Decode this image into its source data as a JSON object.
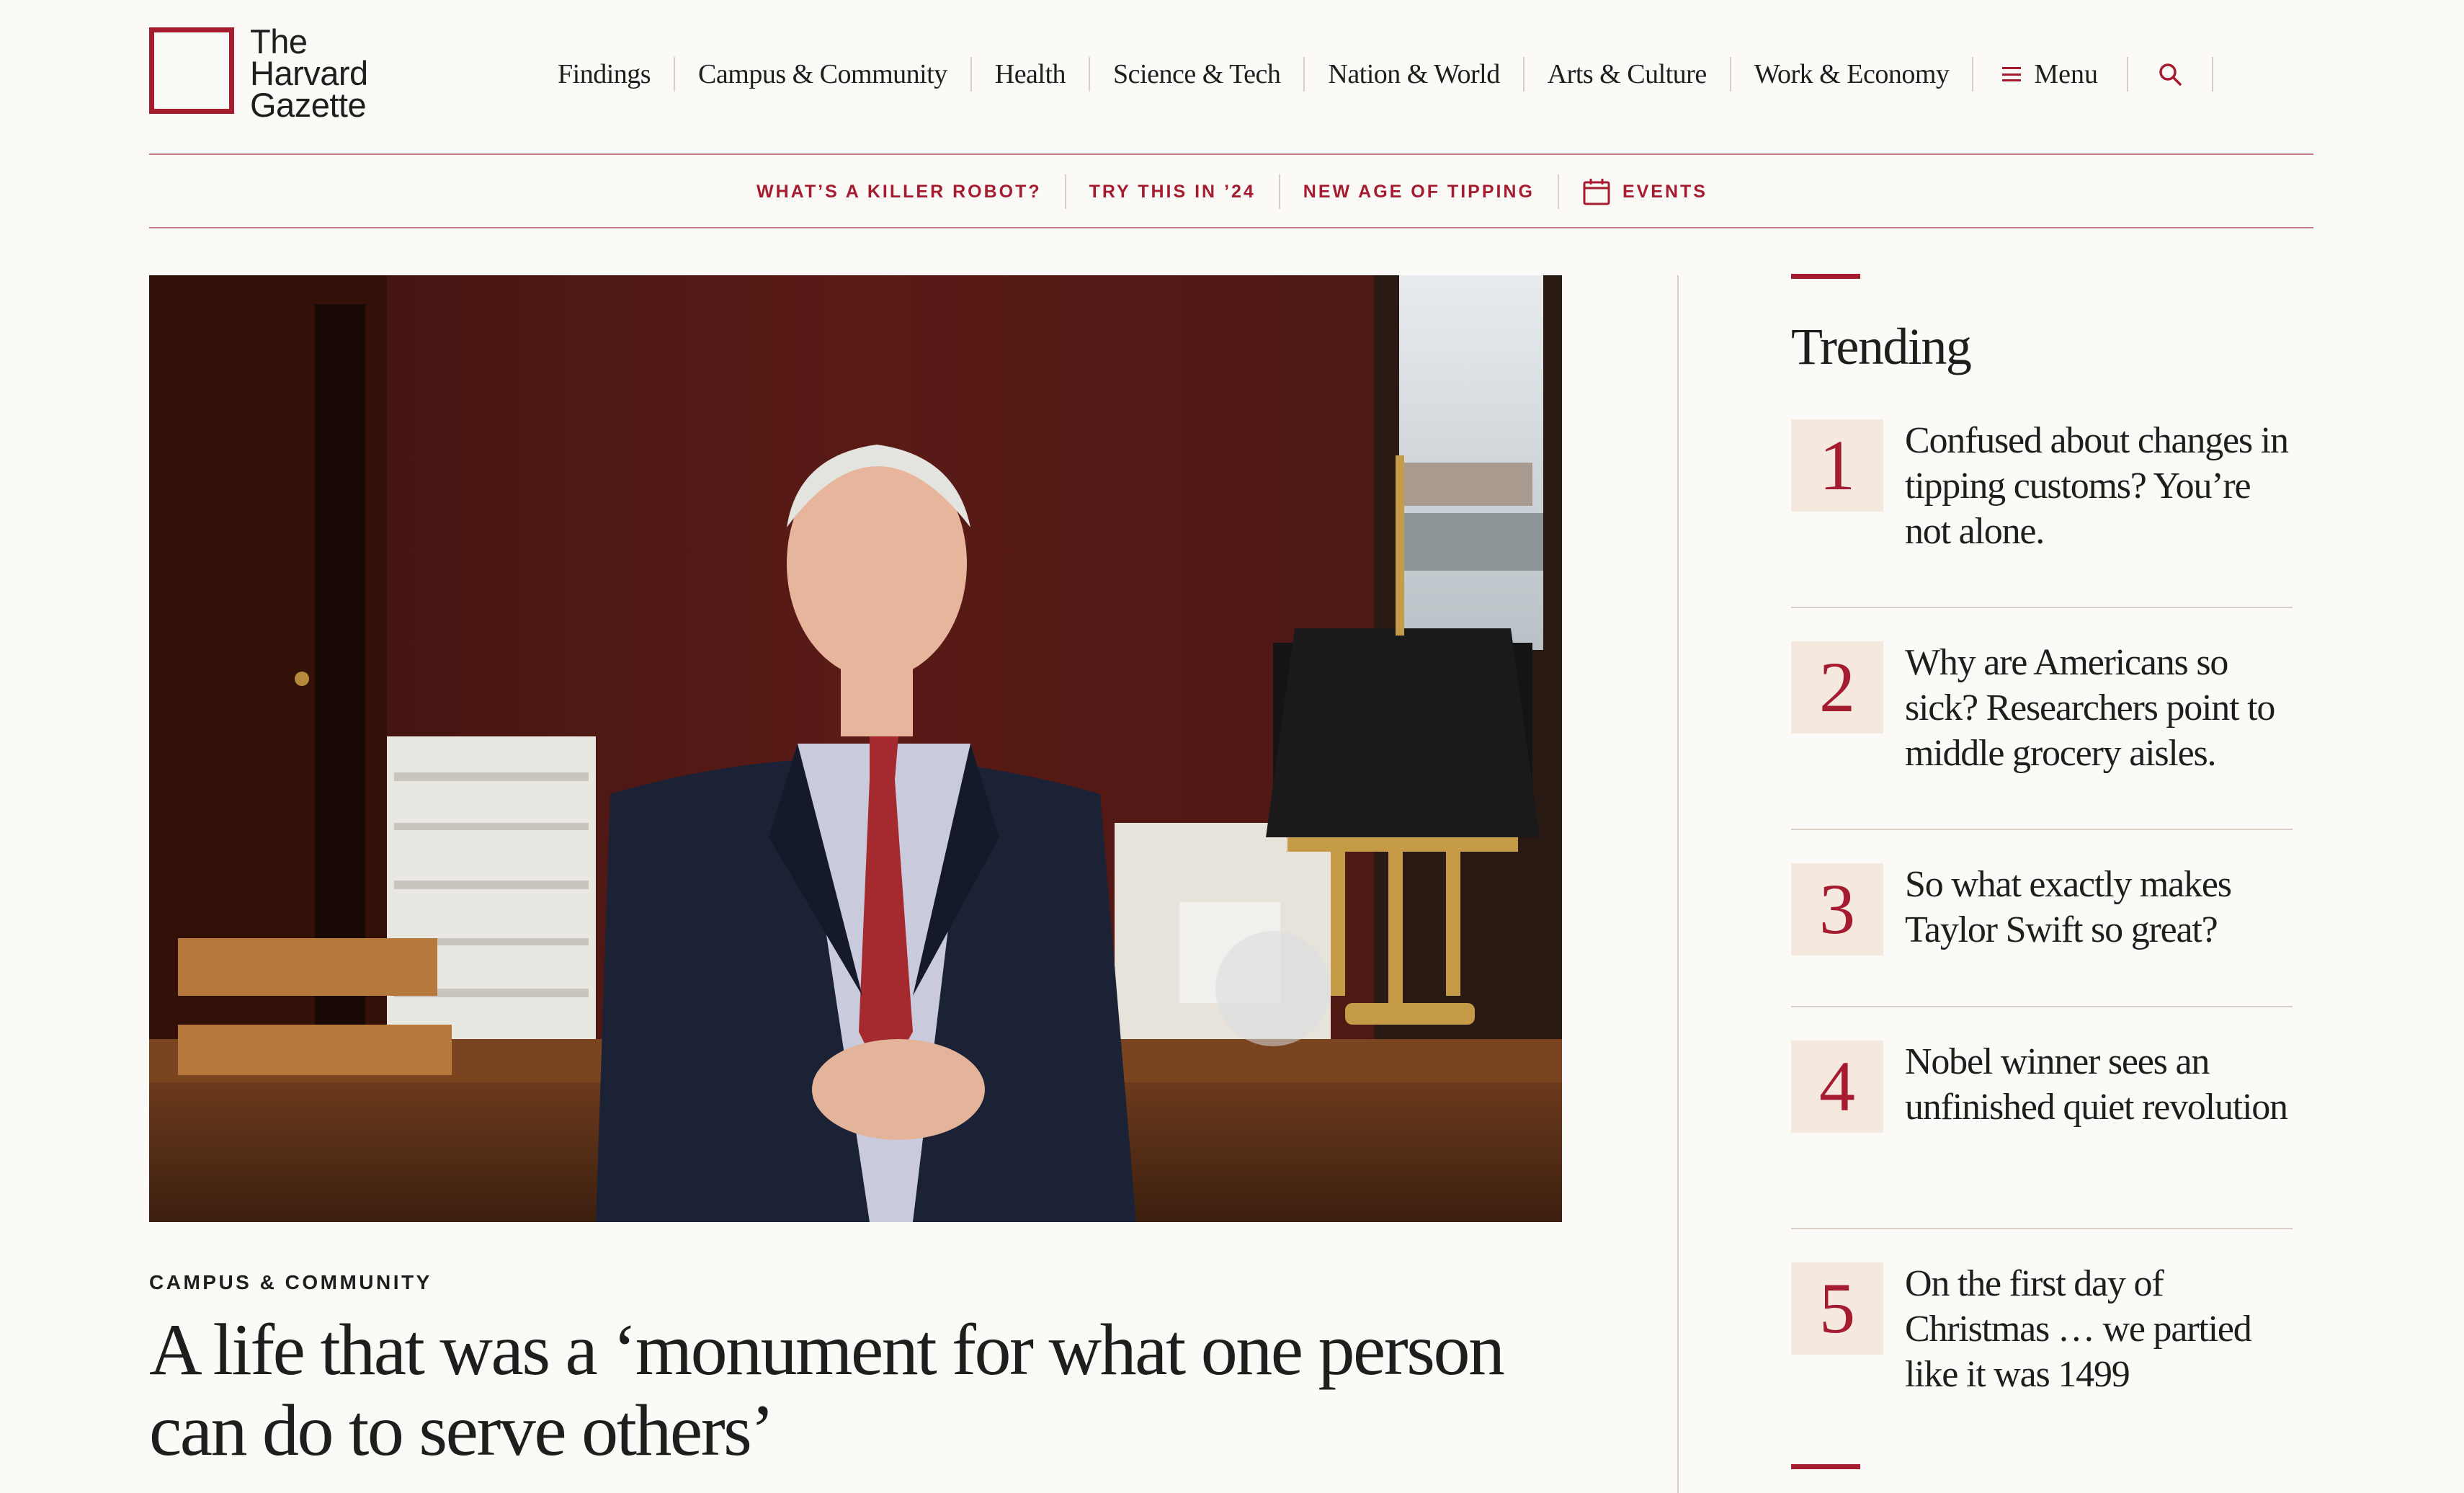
{
  "logo": {
    "line1": "The",
    "line2": "Harvard",
    "line3": "Gazette"
  },
  "nav": {
    "items": [
      {
        "label": "Findings"
      },
      {
        "label": "Campus & Community"
      },
      {
        "label": "Health"
      },
      {
        "label": "Science & Tech"
      },
      {
        "label": "Nation & World"
      },
      {
        "label": "Arts & Culture"
      },
      {
        "label": "Work & Economy"
      }
    ],
    "menu_label": "Menu",
    "menu_icon": "hamburger-icon",
    "search_icon": "search-icon"
  },
  "subnav": {
    "items": [
      {
        "label": "WHAT’S A KILLER ROBOT?"
      },
      {
        "label": "TRY THIS IN ’24"
      },
      {
        "label": "NEW AGE OF TIPPING"
      }
    ],
    "events_label": "EVENTS",
    "events_icon": "calendar-icon"
  },
  "hero": {
    "category": "CAMPUS & COMMUNITY",
    "headline": "A life that was a ‘monument for what one person can do to serve others’"
  },
  "trending": {
    "title": "Trending",
    "items": [
      {
        "num": "1",
        "title": "Confused about changes in tipping customs? You’re not alone."
      },
      {
        "num": "2",
        "title": "Why are Americans so sick? Researchers point to middle grocery aisles."
      },
      {
        "num": "3",
        "title": "So what exactly makes Taylor Swift so great?"
      },
      {
        "num": "4",
        "title": "Nobel winner sees an unfinished quiet revolution"
      },
      {
        "num": "5",
        "title": "On the first day of Christmas … we partied like it was 1499"
      }
    ]
  },
  "colors": {
    "accent": "#a51c30",
    "background": "#fcfaf6",
    "number_tile": "#f4e8df",
    "divider": "#d9cfc7"
  }
}
